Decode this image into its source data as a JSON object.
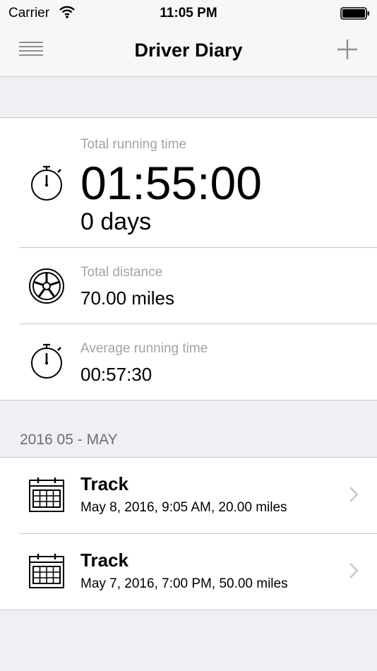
{
  "status_bar": {
    "carrier": "Carrier",
    "time": "11:05 PM"
  },
  "nav": {
    "title": "Driver Diary",
    "menu_icon": "hamburger-icon",
    "add_icon": "plus-icon"
  },
  "stats": {
    "total_running_time": {
      "label": "Total running time",
      "value": "01:55:00",
      "days": "0 days",
      "icon": "stopwatch-icon"
    },
    "total_distance": {
      "label": "Total distance",
      "value": "70.00 miles",
      "icon": "wheel-icon"
    },
    "average_running_time": {
      "label": "Average running time",
      "value": "00:57:30",
      "icon": "stopwatch-icon"
    }
  },
  "section": {
    "header": "2016 05 - MAY",
    "tracks": [
      {
        "title": "Track",
        "subtitle": "May 8, 2016, 9:05 AM, 20.00 miles",
        "icon": "calendar-icon"
      },
      {
        "title": "Track",
        "subtitle": "May 7, 2016, 7:00 PM, 50.00 miles",
        "icon": "calendar-icon"
      }
    ]
  },
  "colors": {
    "background": "#efeff4",
    "card": "#ffffff",
    "label_gray": "#a3a3a8",
    "chevron_gray": "#c7c7cc",
    "separator": "#c8c7cc"
  }
}
